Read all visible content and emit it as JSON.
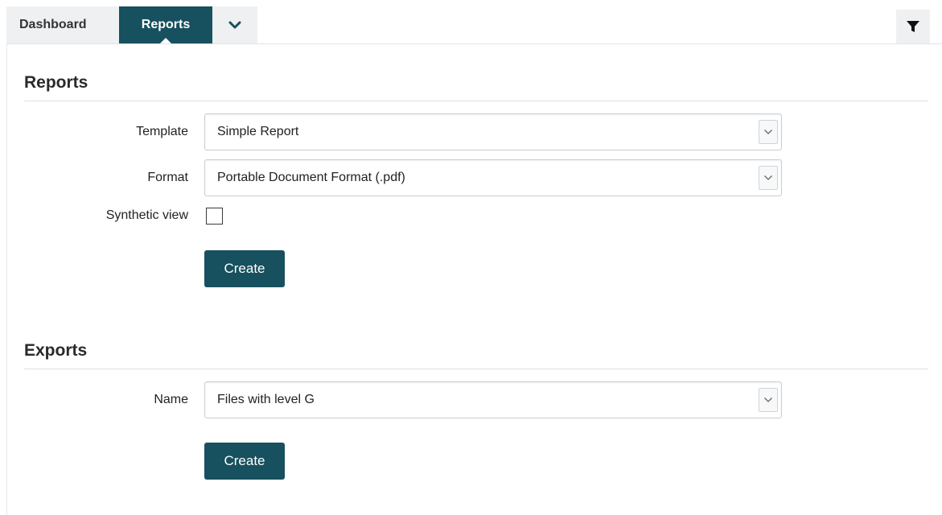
{
  "tabs": {
    "dashboard": "Dashboard",
    "reports": "Reports",
    "more_icon": "chevron-down-icon",
    "filter_icon": "filter-icon"
  },
  "reports": {
    "title": "Reports",
    "template_label": "Template",
    "template_value": "Simple Report",
    "format_label": "Format",
    "format_value": "Portable Document Format (.pdf)",
    "synthetic_label": "Synthetic view",
    "synthetic_checked": false,
    "create_label": "Create"
  },
  "exports": {
    "title": "Exports",
    "name_label": "Name",
    "name_value": "Files with level G",
    "create_label": "Create"
  },
  "colors": {
    "accent": "#17505e",
    "tab_inactive": "#eef0f2"
  }
}
